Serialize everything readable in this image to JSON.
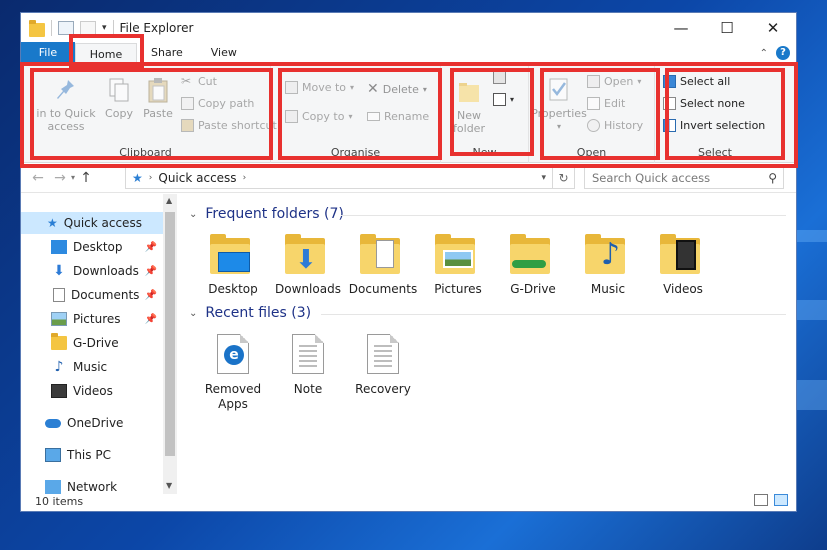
{
  "window": {
    "title": "File Explorer",
    "controls": {
      "minimize": "—",
      "maximize": "☐",
      "close": "✕"
    }
  },
  "tabs": {
    "file": "File",
    "home": "Home",
    "share": "Share",
    "view": "View"
  },
  "ribbon": {
    "clipboard": {
      "label": "Clipboard",
      "pin": "in to Quick access",
      "copy": "Copy",
      "paste": "Paste",
      "cut": "Cut",
      "copy_path": "Copy path",
      "paste_shortcut": "Paste shortcut"
    },
    "organise": {
      "label": "Organise",
      "move_to": "Move to",
      "copy_to": "Copy to",
      "delete": "Delete",
      "rename": "Rename"
    },
    "new": {
      "label": "New",
      "new_folder": "New folder"
    },
    "open": {
      "label": "Open",
      "properties": "Properties",
      "open": "Open",
      "edit": "Edit",
      "history": "History"
    },
    "select": {
      "label": "Select",
      "select_all": "Select all",
      "select_none": "Select none",
      "invert": "Invert selection"
    }
  },
  "address": {
    "path": "Quick access",
    "search_placeholder": "Search Quick access"
  },
  "nav": {
    "quick_access": "Quick access",
    "items": [
      {
        "label": "Desktop",
        "icon": "desktop-icon",
        "pinned": true
      },
      {
        "label": "Downloads",
        "icon": "download-icon",
        "pinned": true
      },
      {
        "label": "Documents",
        "icon": "documents-icon",
        "pinned": true
      },
      {
        "label": "Pictures",
        "icon": "pictures-icon",
        "pinned": true
      },
      {
        "label": "G-Drive",
        "icon": "gdrive-icon",
        "pinned": false
      },
      {
        "label": "Music",
        "icon": "music-icon",
        "pinned": false
      },
      {
        "label": "Videos",
        "icon": "videos-icon",
        "pinned": false
      }
    ],
    "onedrive": "OneDrive",
    "this_pc": "This PC",
    "network": "Network"
  },
  "frequent": {
    "header": "Frequent folders (7)",
    "folders": [
      "Desktop",
      "Downloads",
      "Documents",
      "Pictures",
      "G-Drive",
      "Music",
      "Videos"
    ]
  },
  "recent": {
    "header": "Recent files (3)",
    "files": [
      "Removed Apps",
      "Note",
      "Recovery"
    ]
  },
  "status": {
    "items": "10 items"
  },
  "colors": {
    "accent": "#1979ca",
    "highlight": "#e8312f",
    "folder": "#f7d56b",
    "section_title": "#1e3287"
  }
}
